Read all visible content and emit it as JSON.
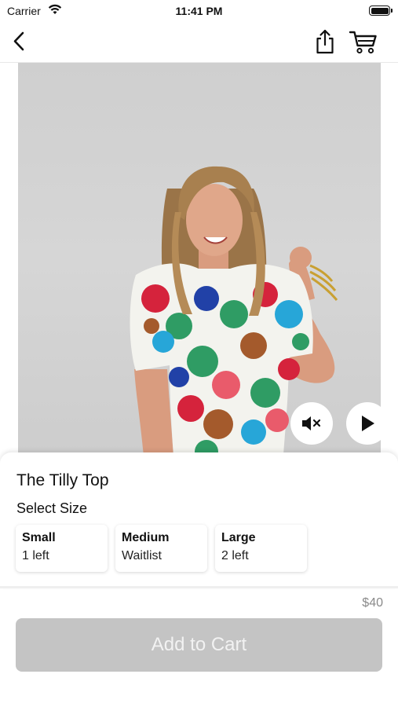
{
  "status_bar": {
    "carrier": "Carrier",
    "time": "11:41 PM"
  },
  "nav": {
    "back_icon": "chevron-left-icon",
    "share_icon": "share-icon",
    "cart_icon": "cart-icon"
  },
  "media": {
    "mute_icon": "speaker-muted-icon",
    "play_icon": "play-icon"
  },
  "product": {
    "title": "The Tilly Top",
    "size_heading": "Select Size",
    "sizes": [
      {
        "name": "Small",
        "stock": "1 left"
      },
      {
        "name": "Medium",
        "stock": "Waitlist"
      },
      {
        "name": "Large",
        "stock": "2 left"
      }
    ],
    "price": "$40"
  },
  "actions": {
    "add_to_cart": "Add to Cart"
  },
  "colors": {
    "button_disabled": "#c4c4c4",
    "price_gray": "#8a8a8a",
    "backdrop": "#d3d3d3"
  }
}
